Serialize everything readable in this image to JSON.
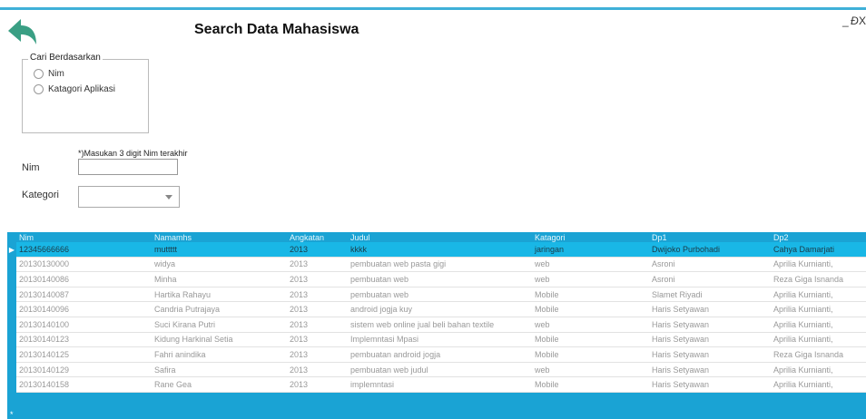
{
  "window": {
    "title": "Search Data Mahasiswa",
    "controls": {
      "minimize": "_",
      "restore": "Ɖ",
      "close": "X"
    }
  },
  "icons": {
    "back": "back-arrow-icon"
  },
  "colors": {
    "accent": "#1aa3d4",
    "selected_row": "#19b7e6",
    "back_icon": "#3a9f84"
  },
  "search_by": {
    "legend": "Cari Berdasarkan",
    "options": [
      "Nim",
      "Katagori Aplikasi"
    ]
  },
  "form": {
    "hint": "*)Masukan 3 digit Nim terakhir",
    "nim_label": "Nim",
    "nim_value": "",
    "kategori_label": "Kategori",
    "kategori_value": ""
  },
  "table": {
    "columns": [
      "Nim",
      "Namamhs",
      "Angkatan",
      "Judul",
      "Katagori",
      "Dp1",
      "Dp2"
    ],
    "rows": [
      [
        "12345666666",
        "muttttt",
        "2013",
        "kkkk",
        "jaringan",
        "Dwijoko Purbohadi",
        "Cahya Damarjati"
      ],
      [
        "20130130000",
        "widya",
        "2013",
        "pembuatan web pasta gigi",
        "web",
        "Asroni",
        "Aprilia Kurnianti,"
      ],
      [
        "20130140086",
        "Minha",
        "2013",
        "pembuatan web",
        "web",
        "Asroni",
        "Reza Giga Isnanda"
      ],
      [
        "20130140087",
        "Hartika Rahayu",
        "2013",
        "pembuatan web",
        "Mobile",
        "Slamet Riyadi",
        "Aprilia Kurnianti,"
      ],
      [
        "20130140096",
        "Candria Putrajaya",
        "2013",
        "android jogja kuy",
        "Mobile",
        "Haris Setyawan",
        "Aprilia Kurnianti,"
      ],
      [
        "20130140100",
        "Suci Kirana Putri",
        "2013",
        "sistem web online jual beli bahan textile",
        "web",
        "Haris Setyawan",
        "Aprilia Kurnianti,"
      ],
      [
        "20130140123",
        "Kidung Harkinal Setia",
        "2013",
        "Implemntasi Mpasi",
        "Mobile",
        "Haris Setyawan",
        "Aprilia Kurnianti,"
      ],
      [
        "20130140125",
        "Fahri anindika",
        "2013",
        "pembuatan android jogja",
        "Mobile",
        "Haris Setyawan",
        "Reza Giga Isnanda"
      ],
      [
        "20130140129",
        "Safira",
        "2013",
        "pembuatan web judul",
        "web",
        "Haris Setyawan",
        "Aprilia Kurnianti,"
      ],
      [
        "20130140158",
        "Rane Gea",
        "2013",
        "implemntasi",
        "Mobile",
        "Haris Setyawan",
        "Aprilia Kurnianti,"
      ]
    ],
    "selected_row": 0,
    "row_pointer": "▶",
    "new_row_glyph": "*"
  }
}
